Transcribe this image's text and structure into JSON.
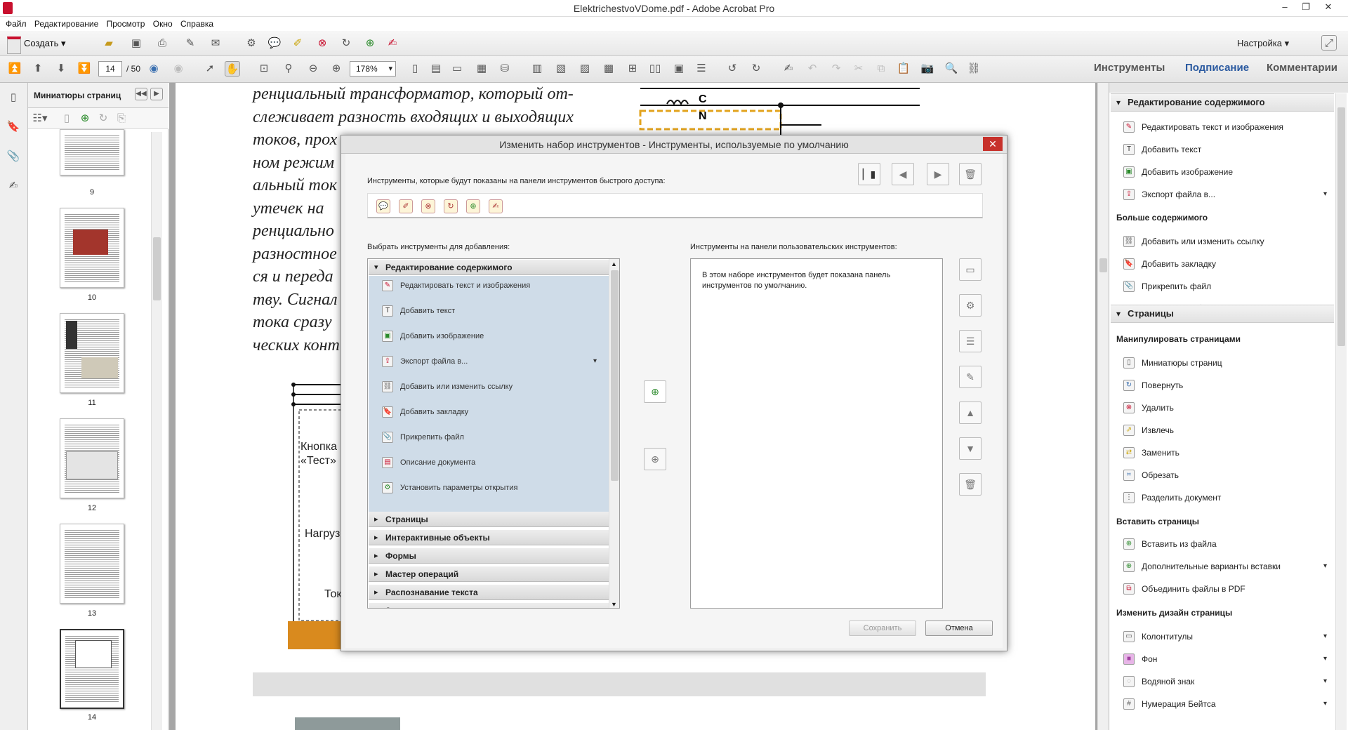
{
  "window": {
    "title": "ElektrichestvoVDome.pdf - Adobe Acrobat Pro"
  },
  "menu": [
    "Файл",
    "Редактирование",
    "Просмотр",
    "Окно",
    "Справка"
  ],
  "toolbar": {
    "create_label": "Создать",
    "customize_label": "Настройка",
    "current_page": "14",
    "total_pages": "/ 50",
    "zoom": "178%"
  },
  "nav_tabs": [
    "Инструменты",
    "Подписание",
    "Комментарии"
  ],
  "thumbnails": {
    "title": "Миниатюры страниц",
    "pages": [
      "9",
      "10",
      "11",
      "12",
      "13",
      "14"
    ]
  },
  "document": {
    "lines": [
      "ренциальный трансформатор, который от-",
      "слеживает разность входящих и выходящих",
      "токов, прох",
      "ном режим",
      "альный ток",
      "утечек на",
      "ренциально",
      "разностное",
      "ся и переда",
      "тву. Сигнал",
      "тока сразу",
      "ческих конт"
    ],
    "circuit_labels": [
      "Кнопка",
      "«Тест»",
      "Нагруз",
      "Ток",
      "С",
      "N"
    ]
  },
  "dialog": {
    "title": "Изменить набор инструментов - Инструменты, используемые по умолчанию",
    "quick_label": "Инструменты, которые будут показаны на панели инструментов быстрого доступа:",
    "select_label": "Выбрать инструменты для добавления:",
    "custom_label": "Инструменты на панели пользовательских инструментов:",
    "custom_message": "В этом наборе инструментов будет показана панель инструментов по умолчанию.",
    "open_group": "Редактирование содержимого",
    "open_items": [
      {
        "label": "Редактировать текст и изображения",
        "icon": "edit-text-icon"
      },
      {
        "label": "Добавить текст",
        "icon": "text-icon"
      },
      {
        "label": "Добавить изображение",
        "icon": "image-icon"
      },
      {
        "label": "Экспорт файла в...",
        "icon": "export-icon",
        "dropdown": true
      },
      {
        "label": "Добавить или изменить ссылку",
        "icon": "link-icon"
      },
      {
        "label": "Добавить закладку",
        "icon": "bookmark-icon"
      },
      {
        "label": "Прикрепить файл",
        "icon": "paperclip-icon"
      },
      {
        "label": "Описание документа",
        "icon": "document-icon"
      },
      {
        "label": "Установить параметры открытия",
        "icon": "open-options-icon"
      }
    ],
    "collapsed_groups": [
      "Страницы",
      "Интерактивные объекты",
      "Формы",
      "Мастер операций",
      "Распознавание текста",
      "Защита"
    ],
    "save_label": "Сохранить",
    "cancel_label": "Отмена"
  },
  "right_panel": {
    "sections": [
      {
        "title": "Редактирование содержимого",
        "items": [
          {
            "label": "Редактировать текст и изображения"
          },
          {
            "label": "Добавить текст"
          },
          {
            "label": "Добавить изображение"
          },
          {
            "label": "Экспорт файла в...",
            "dropdown": true
          }
        ],
        "sub": "Больше содержимого",
        "sub_items": [
          {
            "label": "Добавить или изменить ссылку"
          },
          {
            "label": "Добавить закладку"
          },
          {
            "label": "Прикрепить файл"
          }
        ]
      },
      {
        "title": "Страницы",
        "groups": [
          {
            "sub": "Манипулировать страницами",
            "items": [
              "Миниатюры страниц",
              "Повернуть",
              "Удалить",
              "Извлечь",
              "Заменить",
              "Обрезать",
              "Разделить документ"
            ]
          },
          {
            "sub": "Вставить страницы",
            "items": [
              "Вставить из файла",
              "Дополнительные варианты вставки",
              "Объединить файлы в PDF"
            ]
          },
          {
            "sub": "Изменить дизайн страницы",
            "items": [
              "Колонтитулы",
              "Фон",
              "Водяной знак",
              "Нумерация Бейтса"
            ]
          }
        ]
      }
    ]
  },
  "colors": {
    "accent_red": "#c8102e",
    "selection_blue": "#cfdce8",
    "close_red": "#c7312b",
    "doc_orange": "#d98a1e"
  }
}
